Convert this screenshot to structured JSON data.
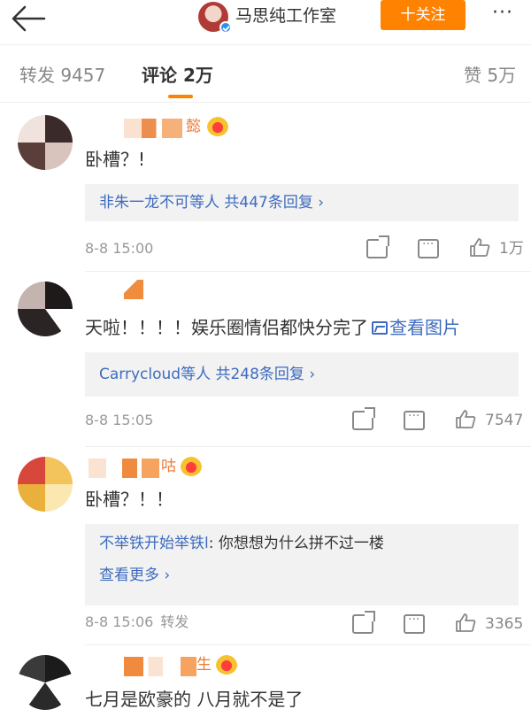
{
  "header": {
    "title": "马思纯工作室",
    "follow_label": "十关注",
    "more_label": "···"
  },
  "tabs": {
    "repost": "转发 9457",
    "comment": "评论 2万",
    "like": "赞 5万"
  },
  "comments": [
    {
      "name_fragment": "懿",
      "text": "卧槽？!",
      "reply": {
        "link": "非朱一龙不可等人",
        "count": "共447条回复",
        "chev": "›"
      },
      "time": "8-8 15:00",
      "likes": "1万"
    },
    {
      "text": "天啦！！！！娱乐圈情侣都快分完了",
      "image_link": "查看图片",
      "reply": {
        "link": "Carrycloud等人",
        "count": "共248条回复",
        "chev": "›"
      },
      "time": "8-8 15:05",
      "likes": "7547"
    },
    {
      "name_fragment": "咕",
      "text": "卧槽？！！",
      "reply_user": "不举铁开始举铁l",
      "reply_text": ": 你想想为什么拼不过一楼",
      "see_more": "查看更多 ›",
      "time": "8-8 15:06",
      "repost": "转发",
      "likes": "3365"
    },
    {
      "name_fragment": "生",
      "text": "七月是欧豪的 八月就不是了"
    }
  ],
  "colors": {
    "accent": "#ff8200",
    "link": "#3e6bbf",
    "muted": "#999999"
  }
}
